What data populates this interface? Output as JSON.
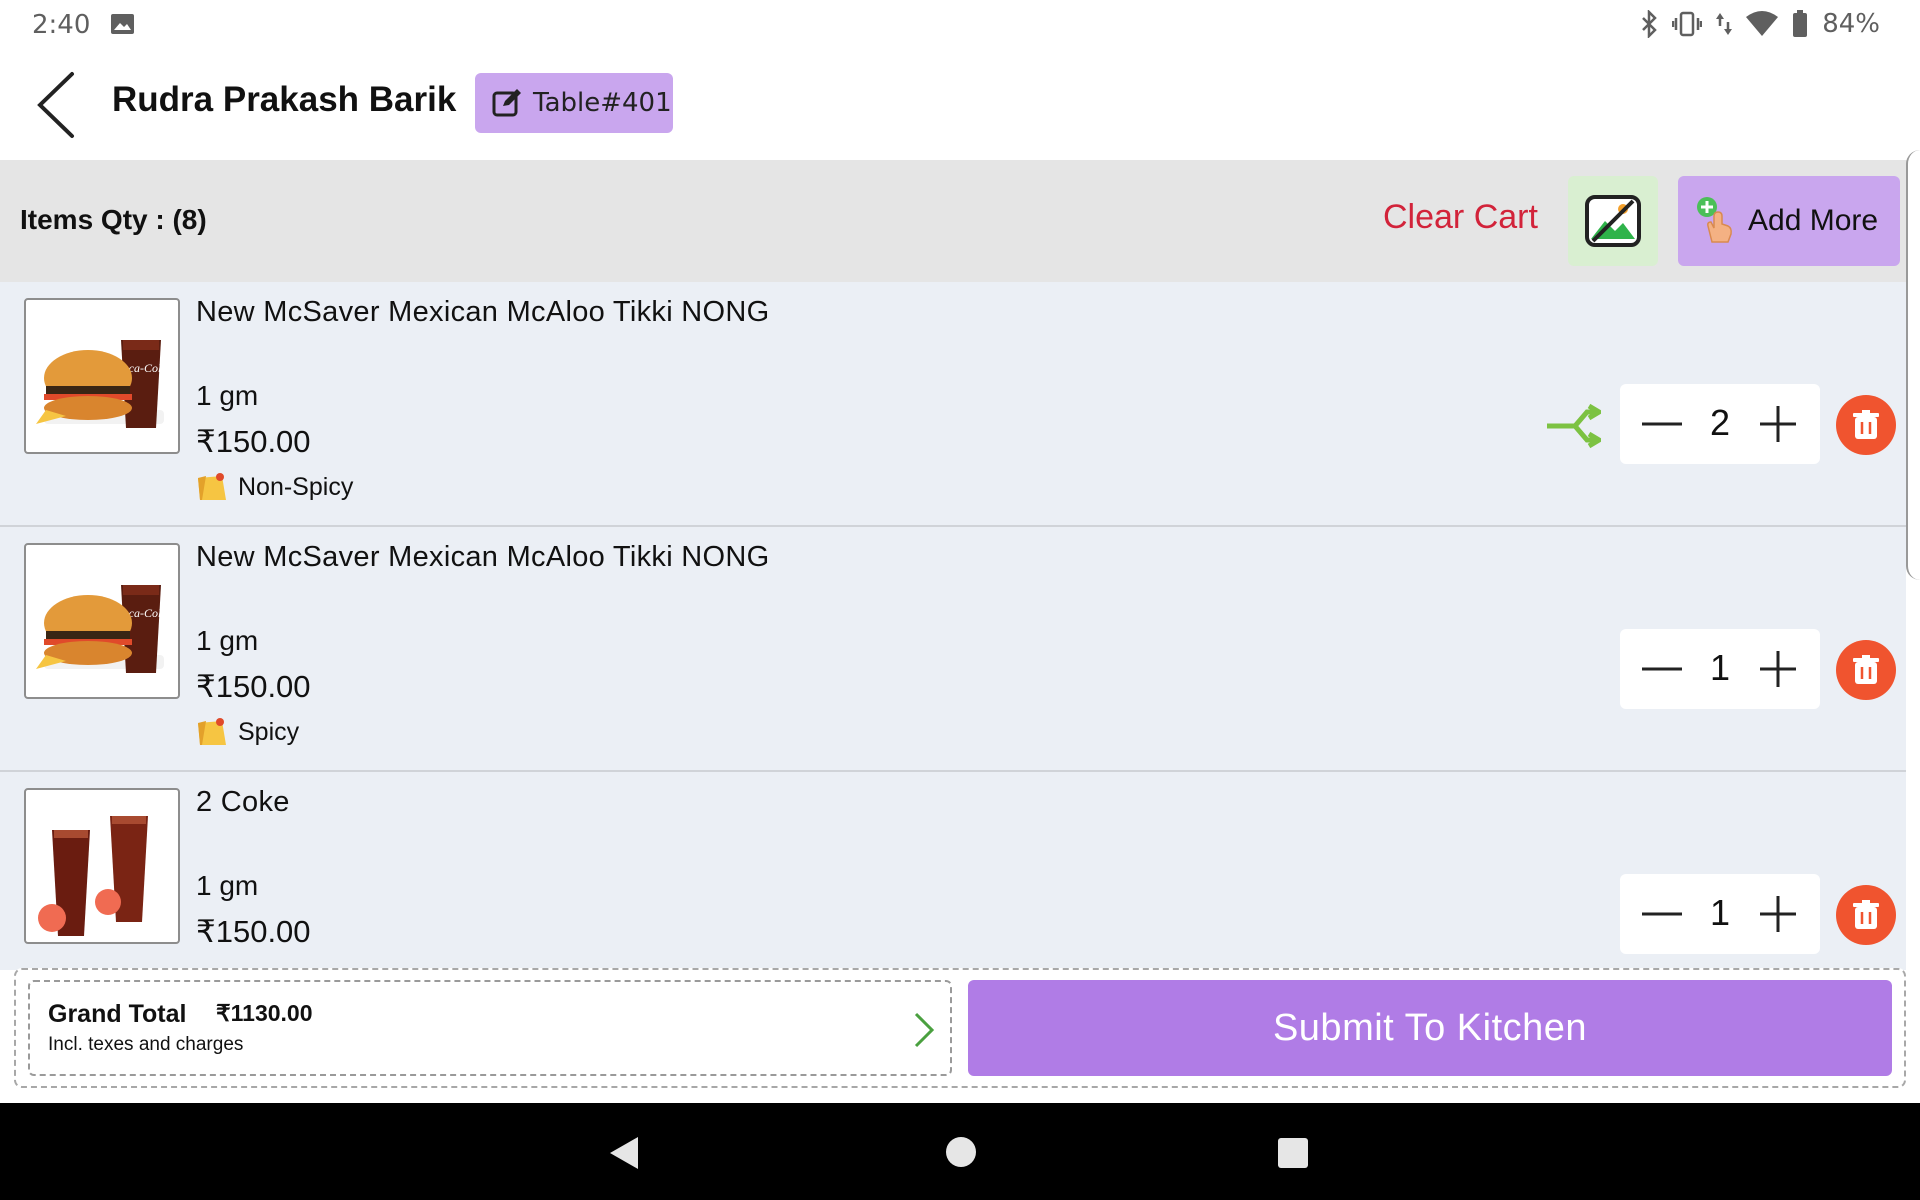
{
  "status_bar": {
    "time": "2:40",
    "battery": "84%",
    "icons": [
      "image-icon",
      "bluetooth-icon",
      "vibrate-icon",
      "data-icon",
      "wifi-icon",
      "battery-icon"
    ]
  },
  "header": {
    "customer_name": "Rudra Prakash Barik",
    "table_label": "Table#401"
  },
  "cart_bar": {
    "items_qty_label": "Items Qty : (8)",
    "clear_cart_label": "Clear Cart",
    "add_more_label": "Add More"
  },
  "items": [
    {
      "name": "New McSaver Mexican McAloo Tikki NONG",
      "weight": "1 gm",
      "price": "₹150.00",
      "note": "Non-Spicy",
      "qty": "2",
      "thumb": "burger-coke-image",
      "has_merge_icon": true
    },
    {
      "name": "New McSaver Mexican McAloo Tikki NONG",
      "weight": "1 gm",
      "price": "₹150.00",
      "note": "Spicy",
      "qty": "1",
      "thumb": "burger-coke-image",
      "has_merge_icon": false
    },
    {
      "name": "2 Coke",
      "weight": "1 gm",
      "price": "₹150.00",
      "note": "",
      "qty": "1",
      "thumb": "coke-cups-image",
      "has_merge_icon": false
    }
  ],
  "footer": {
    "grand_total_label": "Grand Total",
    "grand_total_amount": "₹1130.00",
    "grand_total_sub": "Incl. texes and charges",
    "submit_label": "Submit To Kitchen"
  },
  "colors": {
    "accent_purple": "#b07ce6",
    "badge_purple": "#c9a6ee",
    "clear_red": "#d2233a",
    "delete_orange": "#f0542f",
    "merge_green": "#7cc242"
  }
}
